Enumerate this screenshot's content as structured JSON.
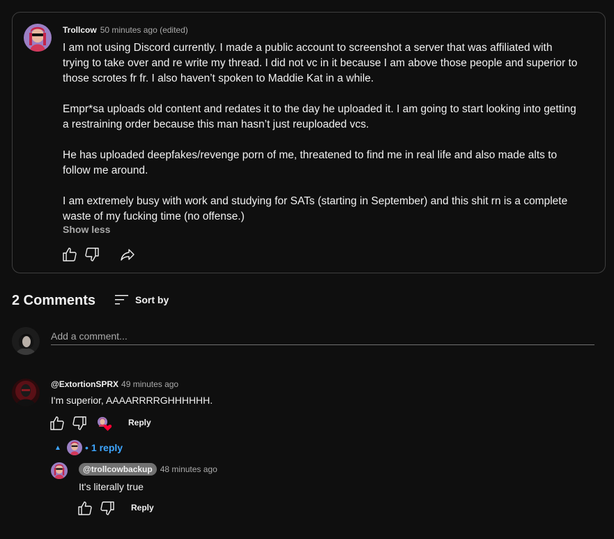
{
  "post": {
    "author": "Trollcow",
    "time": "50 minutes ago (edited)",
    "paragraphs": [
      "I am not using Discord currently. I made a public account to screenshot a server that was affiliated with trying to take over and re write my thread. I did not vc in it because I am above those people and superior to those scrotes fr fr. I also haven’t spoken to Maddie Kat in a while.",
      "Empr*sa uploads old content and redates it to the day he uploaded it. I am going to start looking into getting a restraining order because this man hasn’t just reuploaded vcs.",
      "He has uploaded deepfakes/revenge porn of me, threatened to find me in real life and also made alts to follow me around.",
      "I am extremely busy with work and studying for SATs (starting in September) and this shit rn is a complete waste of my fucking time (no offense.)"
    ],
    "show_less": "Show less"
  },
  "comments_section": {
    "count_label": "2 Comments",
    "sort_label": "Sort by",
    "add_placeholder": "Add a comment..."
  },
  "comment": {
    "author": "@ExtortionSPRX",
    "time": "49 minutes ago",
    "text": "I'm superior, AAAARRRRGHHHHHH.",
    "reply_label": "Reply",
    "replies_label": "1 reply"
  },
  "reply": {
    "mention": "@trollcowbackup",
    "time": "48 minutes ago",
    "text": "It's literally true",
    "reply_label": "Reply"
  },
  "colors": {
    "background": "#0f0f0f",
    "link": "#3ea6ff",
    "secondary_text": "#aaaaaa",
    "heart": "#ff0033"
  },
  "icons": [
    "like-icon",
    "dislike-icon",
    "share-icon",
    "sort-icon",
    "heart-icon",
    "caret-up-icon"
  ]
}
